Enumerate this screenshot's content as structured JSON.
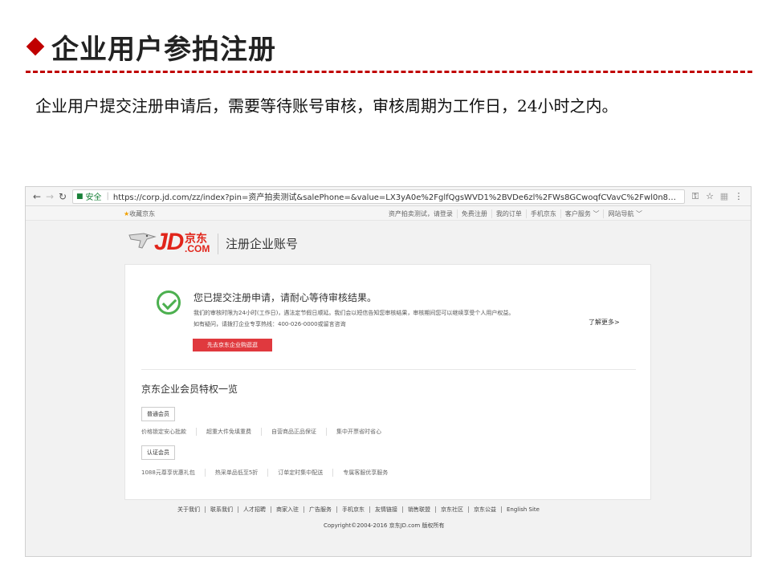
{
  "slide": {
    "title": "企业用户参拍注册",
    "description": "企业用户提交注册申请后，需要等待账号审核，审核周期为工作日，24小时之内。",
    "accent_color": "#c00000"
  },
  "browser": {
    "secure_label": "安全",
    "url": "https://corp.jd.com/zz/index?pin=资产拍卖测试&salePhone=&value=LX3yA0e%2FglfQgsWVD1%2BVDe6zl%2FWs8GCwoqfCVavC%2Fwl0n85SBaGTYWDUzXGN...",
    "icons": [
      "back-icon",
      "forward-icon",
      "reload-icon",
      "lock-icon",
      "key-icon",
      "star-icon",
      "extension-icon",
      "menu-icon"
    ]
  },
  "topbar": {
    "favorite": "收藏京东",
    "links": [
      "资产拍卖测试，请登录",
      "免费注册",
      "我的订单",
      "手机京东",
      "客户服务 ﹀",
      "网站导航 ﹀"
    ]
  },
  "header": {
    "logo_jd": "JD",
    "logo_cn": "京东",
    "logo_com": ".COM",
    "page_title": "注册企业账号",
    "brand_color": "#e1251b"
  },
  "result": {
    "title": "您已提交注册申请，请耐心等待审核结果。",
    "line1": "我们的审核时限为24小时(工作日)，遇法定节假日顺延。我们会以短信告知您审核结果，审核期间您可以继续享受个人用户权益。",
    "line2": "如有疑问，请拨打企业专享热线：400-026-0000或留言咨询",
    "learn_more": "了解更多>",
    "button_label": "先去京东企业购逛逛",
    "success_color": "#4cb04f"
  },
  "benefits": {
    "section_title": "京东企业会员特权一览",
    "groups": [
      {
        "tag": "普通会员",
        "items": [
          "价格锁定安心批款",
          "超重大件免填重费",
          "自营商品正品保证",
          "集中开票省时省心"
        ]
      },
      {
        "tag": "认证会员",
        "items": [
          "1088元尊享优惠礼包",
          "热采单品低至5折",
          "订单定时集中配送",
          "专属客服优享服务"
        ]
      }
    ]
  },
  "footer": {
    "links": [
      "关于我们",
      "联系我们",
      "人才招聘",
      "商家入驻",
      "广告服务",
      "手机京东",
      "友情链接",
      "销售联盟",
      "京东社区",
      "京东公益",
      "English Site"
    ],
    "copyright": "Copyright©2004-2016  京东JD.com 版权所有"
  }
}
